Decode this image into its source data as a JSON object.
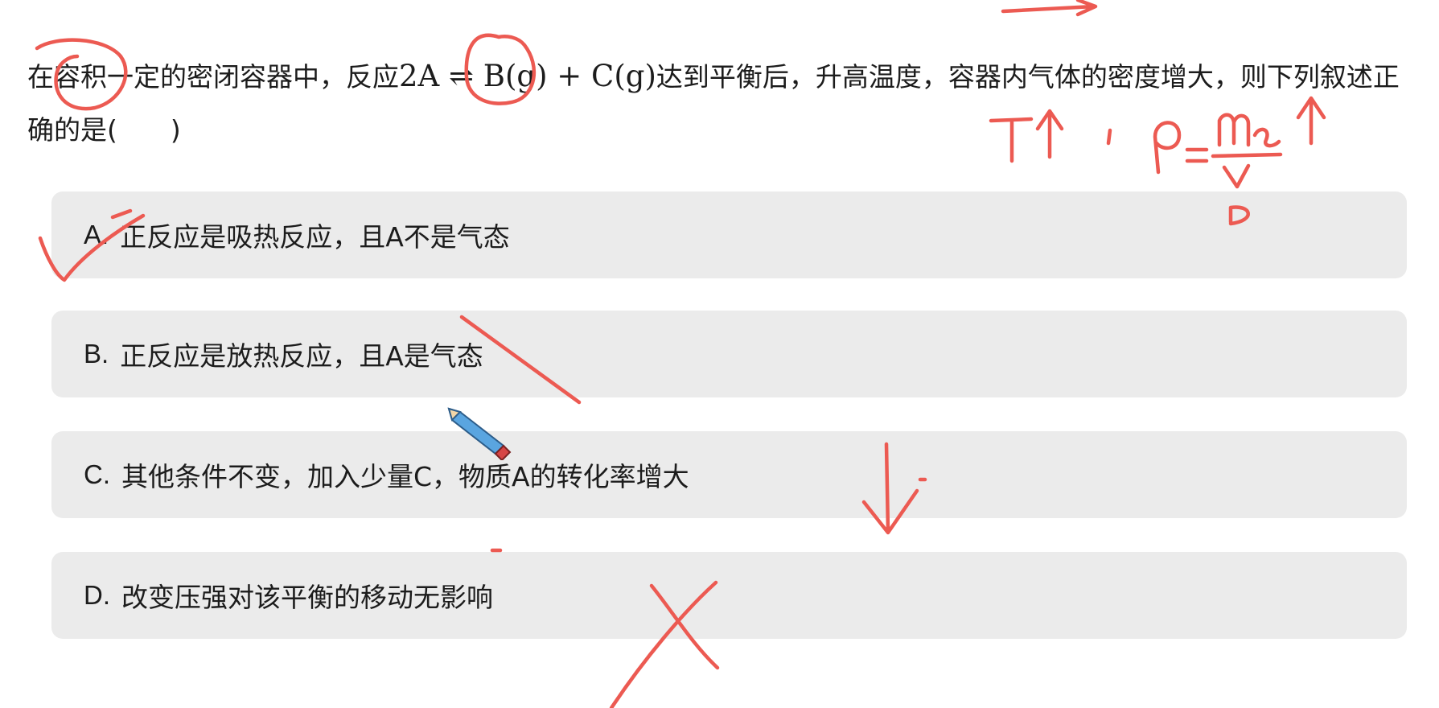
{
  "question": {
    "text_before": "在容积一定的密闭容器中，反应",
    "equation": "2A ⇌ B(g) + C(g)",
    "text_after": "达到平衡后，升高温度，容器内气体的密度增大，则下列叙述正确的是(　　)"
  },
  "options": [
    {
      "letter": "A.",
      "text": "正反应是吸热反应，且A不是气态"
    },
    {
      "letter": "B.",
      "text": "正反应是放热反应，且A是气态"
    },
    {
      "letter": "C.",
      "text": "其他条件不变，加入少量C，物质A的转化率增大"
    },
    {
      "letter": "D.",
      "text": "改变压强对该平衡的移动无影响"
    }
  ],
  "colors": {
    "ink": "#ec5a52",
    "option_bg": "#ebebeb",
    "text": "#1c1c1c"
  },
  "icons": [
    "pencil-cursor-icon"
  ]
}
